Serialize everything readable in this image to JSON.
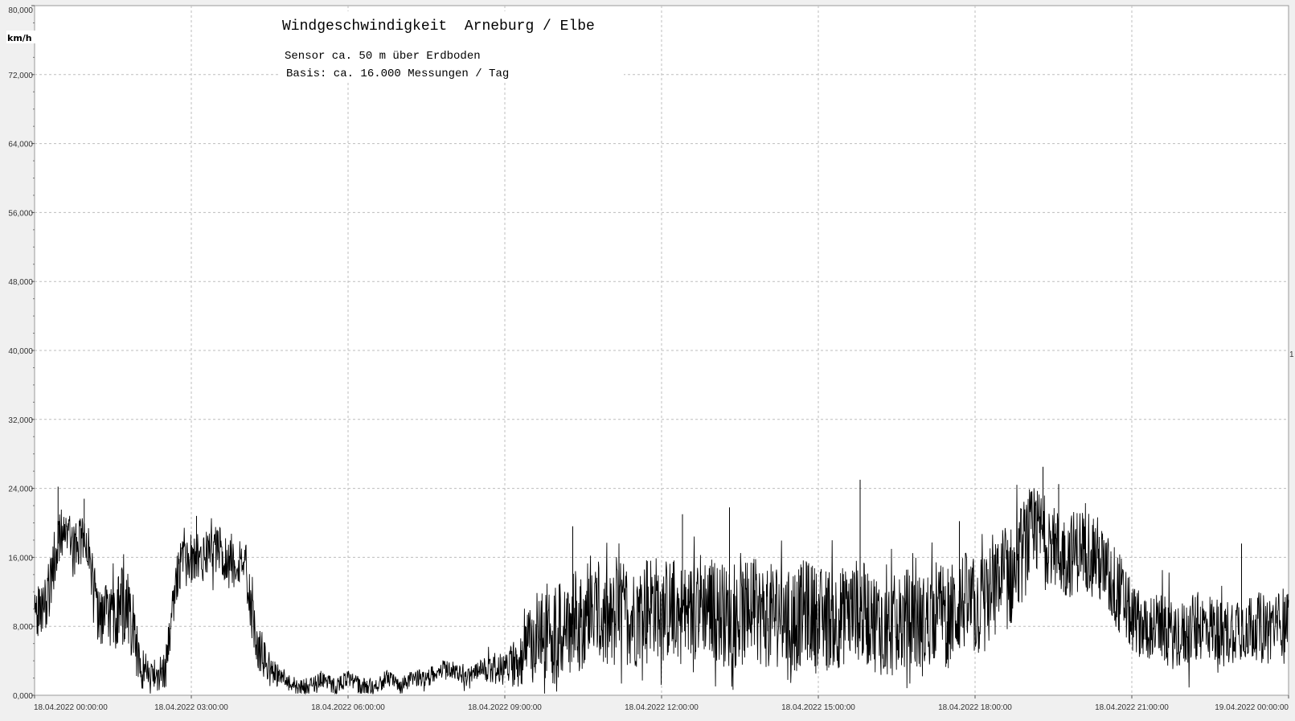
{
  "chart_data": {
    "type": "line",
    "title": "Windgeschwindigkeit  Arneburg / Elbe",
    "subtitle_lines": [
      "Sensor ca. 50 m über Erdboden",
      "Basis: ca. 16.000 Messungen / Tag"
    ],
    "ylabel": "km/h",
    "xlabel": "",
    "ylim": [
      0,
      80
    ],
    "y_ticks": [
      "0,000",
      "8,000",
      "16,000",
      "24,000",
      "32,000",
      "40,000",
      "48,000",
      "56,000",
      "64,000",
      "72,000",
      "80,000"
    ],
    "x_range_hours": [
      0,
      24
    ],
    "x_ticks": [
      {
        "date": "18.04.2022",
        "time": "00:00:00",
        "hour": 0
      },
      {
        "date": "18.04.2022",
        "time": "03:00:00",
        "hour": 3
      },
      {
        "date": "18.04.2022",
        "time": "06:00:00",
        "hour": 6
      },
      {
        "date": "18.04.2022",
        "time": "09:00:00",
        "hour": 9
      },
      {
        "date": "18.04.2022",
        "time": "12:00:00",
        "hour": 12
      },
      {
        "date": "18.04.2022",
        "time": "15:00:00",
        "hour": 15
      },
      {
        "date": "18.04.2022",
        "time": "18:00:00",
        "hour": 18
      },
      {
        "date": "18.04.2022",
        "time": "21:00:00",
        "hour": 21
      },
      {
        "date": "19.04.2022",
        "time": "00:00:00",
        "hour": 24
      }
    ],
    "right_marker": "1",
    "grid": true,
    "line_color": "#000000",
    "series": [
      {
        "x": [
          0,
          0.25,
          0.5,
          0.75,
          1.0,
          1.25,
          1.5,
          1.75,
          2.0,
          2.25,
          2.5,
          2.75,
          3.0,
          3.25,
          3.5,
          3.75,
          4.0,
          4.25,
          4.5,
          4.75,
          5.0,
          5.25,
          5.5,
          5.75,
          6.0,
          6.25,
          6.5,
          6.75,
          7.0,
          7.25,
          7.5,
          7.75,
          8.0,
          8.25,
          8.5,
          8.75,
          9.0,
          9.25,
          9.5,
          9.75,
          10.0,
          10.25,
          10.5,
          10.75,
          11.0,
          11.25,
          11.5,
          11.75,
          12.0,
          12.25,
          12.5,
          12.75,
          13.0,
          13.25,
          13.5,
          13.75,
          14.0,
          14.25,
          14.5,
          14.75,
          15.0,
          15.25,
          15.5,
          15.75,
          16.0,
          16.25,
          16.5,
          16.75,
          17.0,
          17.25,
          17.5,
          17.75,
          18.0,
          18.25,
          18.5,
          18.75,
          19.0,
          19.25,
          19.5,
          19.75,
          20.0,
          20.25,
          20.5,
          20.75,
          21.0,
          21.25,
          21.5,
          21.75,
          22.0,
          22.25,
          22.5,
          22.75,
          23.0,
          23.25,
          23.5,
          23.75,
          24.0
        ],
        "y": [
          8,
          12,
          19,
          18,
          17,
          10,
          9,
          11,
          4,
          2,
          3,
          15,
          16,
          16,
          17,
          15,
          16,
          6,
          3,
          2,
          1,
          1,
          2,
          1,
          2,
          1,
          1,
          2,
          1,
          2,
          2,
          3,
          3,
          2,
          3,
          3,
          3,
          4,
          6,
          8,
          7,
          8,
          9,
          9,
          8,
          10,
          9,
          11,
          10,
          10,
          9,
          11,
          10,
          9,
          9,
          10,
          9,
          10,
          8,
          10,
          9,
          9,
          9,
          10,
          9,
          8,
          8,
          9,
          8,
          10,
          9,
          11,
          10,
          11,
          13,
          14,
          18,
          19,
          17,
          16,
          17,
          17,
          14,
          12,
          9,
          8,
          8,
          7,
          7,
          8,
          8,
          7,
          8,
          8,
          8,
          8,
          9
        ],
        "spread": [
          4,
          4,
          3,
          3,
          3,
          4,
          4,
          5,
          3,
          2,
          2,
          3,
          3,
          3,
          3,
          3,
          3,
          3,
          2,
          1,
          1,
          1,
          1,
          1,
          1,
          1,
          1,
          1,
          1,
          1,
          1,
          1,
          1,
          1,
          1,
          2,
          2,
          3,
          5,
          6,
          6,
          6,
          6,
          6,
          6,
          6,
          6,
          6,
          6,
          6,
          6,
          6,
          6,
          6,
          6,
          6,
          6,
          6,
          6,
          6,
          6,
          6,
          6,
          6,
          6,
          6,
          6,
          6,
          6,
          6,
          6,
          6,
          6,
          6,
          6,
          6,
          6,
          5,
          5,
          5,
          5,
          5,
          5,
          5,
          4,
          4,
          4,
          4,
          4,
          4,
          4,
          4,
          4,
          4,
          4,
          4,
          4
        ],
        "peaks": [
          {
            "x": 0.45,
            "y": 24.2
          },
          {
            "x": 0.95,
            "y": 22.8
          },
          {
            "x": 3.1,
            "y": 20.8
          },
          {
            "x": 10.3,
            "y": 19.6
          },
          {
            "x": 12.4,
            "y": 21
          },
          {
            "x": 13.3,
            "y": 21.8
          },
          {
            "x": 15.8,
            "y": 25
          },
          {
            "x": 17.7,
            "y": 20.2
          },
          {
            "x": 19.3,
            "y": 26.5
          },
          {
            "x": 19.6,
            "y": 24.5
          },
          {
            "x": 23.1,
            "y": 17.6
          }
        ]
      }
    ]
  }
}
